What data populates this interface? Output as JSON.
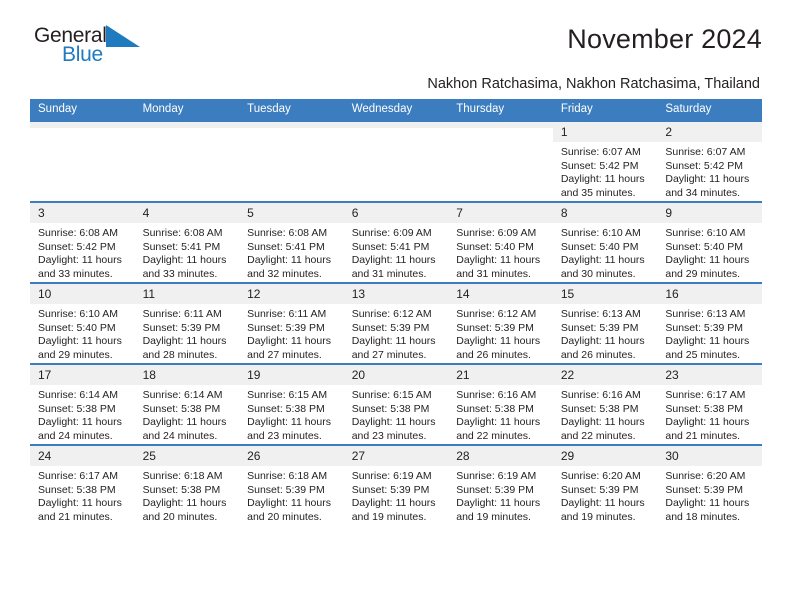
{
  "brand": {
    "name_top": "General",
    "name_bottom": "Blue",
    "triangle_color": "#1f7ac0"
  },
  "header": {
    "title": "November 2024",
    "subtitle": "Nakhon Ratchasima, Nakhon Ratchasima, Thailand",
    "accent_color": "#3b7dbf",
    "daynum_bg": "#f0f0f0"
  },
  "weekday_headers": [
    "Sunday",
    "Monday",
    "Tuesday",
    "Wednesday",
    "Thursday",
    "Friday",
    "Saturday"
  ],
  "labels": {
    "sunrise_prefix": "Sunrise:",
    "sunset_prefix": "Sunset:",
    "daylight_prefix": "Daylight:"
  },
  "weeks": [
    [
      {
        "day": "",
        "empty": true
      },
      {
        "day": "",
        "empty": true
      },
      {
        "day": "",
        "empty": true
      },
      {
        "day": "",
        "empty": true
      },
      {
        "day": "",
        "empty": true
      },
      {
        "day": "1",
        "sunrise": "Sunrise: 6:07 AM",
        "sunset": "Sunset: 5:42 PM",
        "daylight": "Daylight: 11 hours and 35 minutes."
      },
      {
        "day": "2",
        "sunrise": "Sunrise: 6:07 AM",
        "sunset": "Sunset: 5:42 PM",
        "daylight": "Daylight: 11 hours and 34 minutes."
      }
    ],
    [
      {
        "day": "3",
        "sunrise": "Sunrise: 6:08 AM",
        "sunset": "Sunset: 5:42 PM",
        "daylight": "Daylight: 11 hours and 33 minutes."
      },
      {
        "day": "4",
        "sunrise": "Sunrise: 6:08 AM",
        "sunset": "Sunset: 5:41 PM",
        "daylight": "Daylight: 11 hours and 33 minutes."
      },
      {
        "day": "5",
        "sunrise": "Sunrise: 6:08 AM",
        "sunset": "Sunset: 5:41 PM",
        "daylight": "Daylight: 11 hours and 32 minutes."
      },
      {
        "day": "6",
        "sunrise": "Sunrise: 6:09 AM",
        "sunset": "Sunset: 5:41 PM",
        "daylight": "Daylight: 11 hours and 31 minutes."
      },
      {
        "day": "7",
        "sunrise": "Sunrise: 6:09 AM",
        "sunset": "Sunset: 5:40 PM",
        "daylight": "Daylight: 11 hours and 31 minutes."
      },
      {
        "day": "8",
        "sunrise": "Sunrise: 6:10 AM",
        "sunset": "Sunset: 5:40 PM",
        "daylight": "Daylight: 11 hours and 30 minutes."
      },
      {
        "day": "9",
        "sunrise": "Sunrise: 6:10 AM",
        "sunset": "Sunset: 5:40 PM",
        "daylight": "Daylight: 11 hours and 29 minutes."
      }
    ],
    [
      {
        "day": "10",
        "sunrise": "Sunrise: 6:10 AM",
        "sunset": "Sunset: 5:40 PM",
        "daylight": "Daylight: 11 hours and 29 minutes."
      },
      {
        "day": "11",
        "sunrise": "Sunrise: 6:11 AM",
        "sunset": "Sunset: 5:39 PM",
        "daylight": "Daylight: 11 hours and 28 minutes."
      },
      {
        "day": "12",
        "sunrise": "Sunrise: 6:11 AM",
        "sunset": "Sunset: 5:39 PM",
        "daylight": "Daylight: 11 hours and 27 minutes."
      },
      {
        "day": "13",
        "sunrise": "Sunrise: 6:12 AM",
        "sunset": "Sunset: 5:39 PM",
        "daylight": "Daylight: 11 hours and 27 minutes."
      },
      {
        "day": "14",
        "sunrise": "Sunrise: 6:12 AM",
        "sunset": "Sunset: 5:39 PM",
        "daylight": "Daylight: 11 hours and 26 minutes."
      },
      {
        "day": "15",
        "sunrise": "Sunrise: 6:13 AM",
        "sunset": "Sunset: 5:39 PM",
        "daylight": "Daylight: 11 hours and 26 minutes."
      },
      {
        "day": "16",
        "sunrise": "Sunrise: 6:13 AM",
        "sunset": "Sunset: 5:39 PM",
        "daylight": "Daylight: 11 hours and 25 minutes."
      }
    ],
    [
      {
        "day": "17",
        "sunrise": "Sunrise: 6:14 AM",
        "sunset": "Sunset: 5:38 PM",
        "daylight": "Daylight: 11 hours and 24 minutes."
      },
      {
        "day": "18",
        "sunrise": "Sunrise: 6:14 AM",
        "sunset": "Sunset: 5:38 PM",
        "daylight": "Daylight: 11 hours and 24 minutes."
      },
      {
        "day": "19",
        "sunrise": "Sunrise: 6:15 AM",
        "sunset": "Sunset: 5:38 PM",
        "daylight": "Daylight: 11 hours and 23 minutes."
      },
      {
        "day": "20",
        "sunrise": "Sunrise: 6:15 AM",
        "sunset": "Sunset: 5:38 PM",
        "daylight": "Daylight: 11 hours and 23 minutes."
      },
      {
        "day": "21",
        "sunrise": "Sunrise: 6:16 AM",
        "sunset": "Sunset: 5:38 PM",
        "daylight": "Daylight: 11 hours and 22 minutes."
      },
      {
        "day": "22",
        "sunrise": "Sunrise: 6:16 AM",
        "sunset": "Sunset: 5:38 PM",
        "daylight": "Daylight: 11 hours and 22 minutes."
      },
      {
        "day": "23",
        "sunrise": "Sunrise: 6:17 AM",
        "sunset": "Sunset: 5:38 PM",
        "daylight": "Daylight: 11 hours and 21 minutes."
      }
    ],
    [
      {
        "day": "24",
        "sunrise": "Sunrise: 6:17 AM",
        "sunset": "Sunset: 5:38 PM",
        "daylight": "Daylight: 11 hours and 21 minutes."
      },
      {
        "day": "25",
        "sunrise": "Sunrise: 6:18 AM",
        "sunset": "Sunset: 5:38 PM",
        "daylight": "Daylight: 11 hours and 20 minutes."
      },
      {
        "day": "26",
        "sunrise": "Sunrise: 6:18 AM",
        "sunset": "Sunset: 5:39 PM",
        "daylight": "Daylight: 11 hours and 20 minutes."
      },
      {
        "day": "27",
        "sunrise": "Sunrise: 6:19 AM",
        "sunset": "Sunset: 5:39 PM",
        "daylight": "Daylight: 11 hours and 19 minutes."
      },
      {
        "day": "28",
        "sunrise": "Sunrise: 6:19 AM",
        "sunset": "Sunset: 5:39 PM",
        "daylight": "Daylight: 11 hours and 19 minutes."
      },
      {
        "day": "29",
        "sunrise": "Sunrise: 6:20 AM",
        "sunset": "Sunset: 5:39 PM",
        "daylight": "Daylight: 11 hours and 19 minutes."
      },
      {
        "day": "30",
        "sunrise": "Sunrise: 6:20 AM",
        "sunset": "Sunset: 5:39 PM",
        "daylight": "Daylight: 11 hours and 18 minutes."
      }
    ]
  ]
}
